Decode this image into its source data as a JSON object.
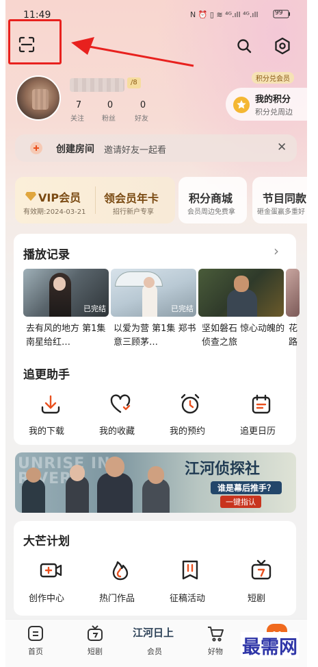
{
  "status": {
    "time": "11:49",
    "battery": "99"
  },
  "profile": {
    "level": "/8",
    "stats": [
      {
        "num": "7",
        "label": "关注"
      },
      {
        "num": "0",
        "label": "粉丝"
      },
      {
        "num": "0",
        "label": "好友"
      }
    ]
  },
  "points": {
    "tag": "积分兑会员",
    "title": "我的积分",
    "sub": "积分兑周边"
  },
  "room": {
    "title": "创建房间",
    "sub": "邀请好友一起看"
  },
  "vip": {
    "title": "VIP会员",
    "expiry": "有效期:2024-03-21",
    "annual_title": "领会员年卡",
    "annual_sub": "招行新户专享"
  },
  "shop": {
    "title": "积分商城",
    "sub": "会员周边免费拿"
  },
  "festival": {
    "title": "节目同款",
    "sub": "砸金蛋赢多重好"
  },
  "history": {
    "title": "播放记录",
    "items": [
      {
        "caption": "去有风的地方 第1集 南星给红…",
        "badge": "已完结"
      },
      {
        "caption": "以爱为营 第1集 郑书意三顾茅…",
        "badge": "已完结"
      },
      {
        "caption": "坚如磐石 惊心动魄的侦查之旅",
        "badge": ""
      },
      {
        "caption": "花路",
        "badge": ""
      }
    ]
  },
  "helper": {
    "title": "追更助手",
    "items": [
      "我的下载",
      "我的收藏",
      "我的预约",
      "追更日历"
    ]
  },
  "banner": {
    "en": "UNRISE IN RIVER",
    "cn_title": "江河侦探社",
    "slogan": "谁是幕后推手？",
    "cta": "一键指认"
  },
  "plan": {
    "title": "大芒计划",
    "items": [
      "创作中心",
      "热门作品",
      "征稿活动",
      "短剧"
    ]
  },
  "nav": {
    "items": [
      "首页",
      "短剧",
      "会员",
      "好物"
    ],
    "logo": "江河日上"
  },
  "watermark": "最需网",
  "colors": {
    "accent": "#f06a1e",
    "red_box": "#e8211e",
    "gold": "#c79a45"
  }
}
